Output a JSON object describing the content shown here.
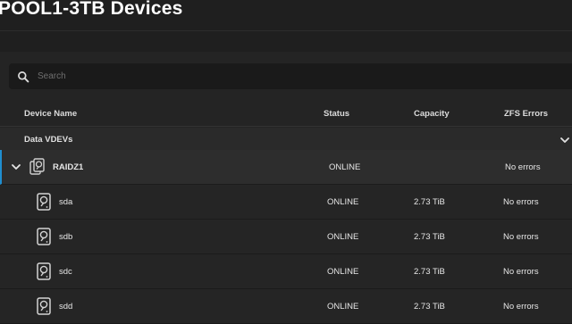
{
  "page": {
    "title": "POOL1-3TB Devices"
  },
  "search": {
    "placeholder": "Search",
    "value": ""
  },
  "table": {
    "columns": [
      "Device Name",
      "Status",
      "Capacity",
      "ZFS Errors"
    ],
    "group": {
      "label": "Data VDEVs"
    },
    "vdev": {
      "name": "RAIDZ1",
      "status": "ONLINE",
      "capacity": "",
      "errors": "No errors",
      "icon": "disk-group-icon"
    },
    "disks": [
      {
        "name": "sda",
        "status": "ONLINE",
        "capacity": "2.73 TiB",
        "errors": "No errors",
        "icon": "hard-disk-icon"
      },
      {
        "name": "sdb",
        "status": "ONLINE",
        "capacity": "2.73 TiB",
        "errors": "No errors",
        "icon": "hard-disk-icon"
      },
      {
        "name": "sdc",
        "status": "ONLINE",
        "capacity": "2.73 TiB",
        "errors": "No errors",
        "icon": "hard-disk-icon"
      },
      {
        "name": "sdd",
        "status": "ONLINE",
        "capacity": "2.73 TiB",
        "errors": "No errors",
        "icon": "hard-disk-icon"
      }
    ]
  },
  "colors": {
    "background": "#1f1f1f",
    "panel": "#242424",
    "accent": "#1f8fd0",
    "text": "#e6e6e6"
  }
}
